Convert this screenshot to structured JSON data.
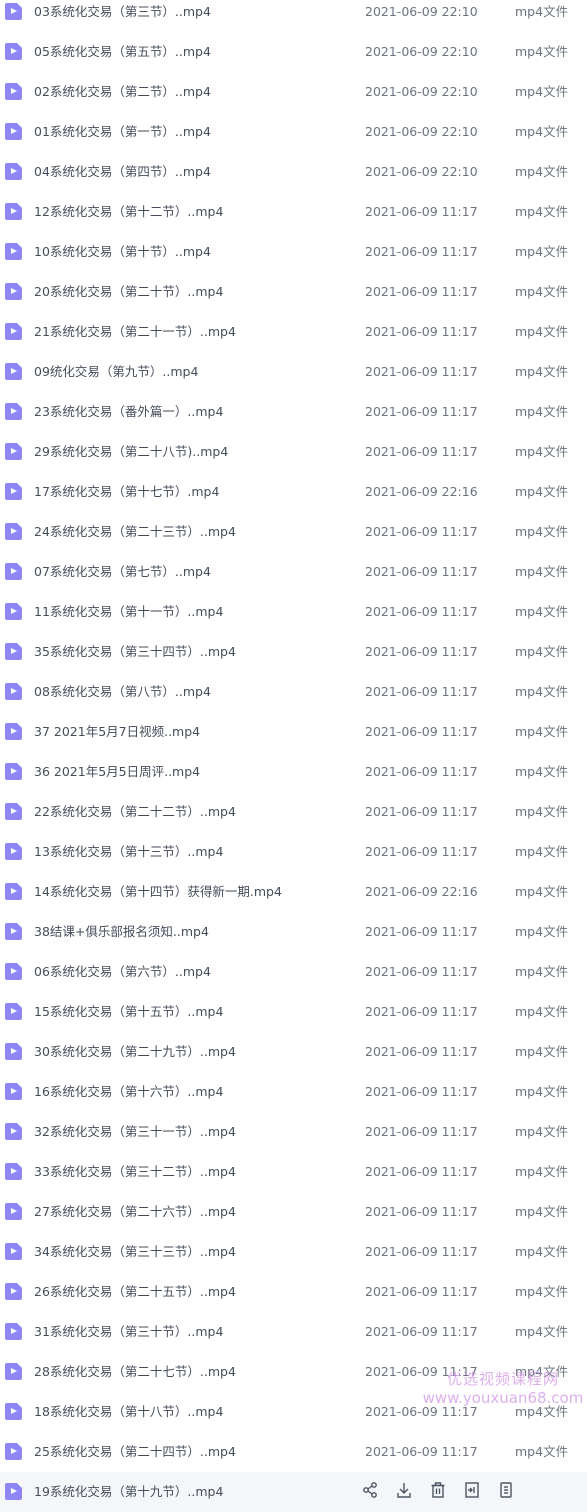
{
  "file_type_label": "mp4文件",
  "files": [
    {
      "name": "03系统化交易（第三节）..mp4",
      "modified": "2021-06-09 22:10"
    },
    {
      "name": "05系统化交易（第五节）..mp4",
      "modified": "2021-06-09 22:10"
    },
    {
      "name": "02系统化交易（第二节）..mp4",
      "modified": "2021-06-09 22:10"
    },
    {
      "name": "01系统化交易（第一节）..mp4",
      "modified": "2021-06-09 22:10"
    },
    {
      "name": "04系统化交易（第四节）..mp4",
      "modified": "2021-06-09 22:10"
    },
    {
      "name": "12系统化交易（第十二节）..mp4",
      "modified": "2021-06-09 11:17"
    },
    {
      "name": "10系统化交易（第十节）..mp4",
      "modified": "2021-06-09 11:17"
    },
    {
      "name": "20系统化交易（第二十节）..mp4",
      "modified": "2021-06-09 11:17"
    },
    {
      "name": "21系统化交易（第二十一节）..mp4",
      "modified": "2021-06-09 11:17"
    },
    {
      "name": "09统化交易（第九节）..mp4",
      "modified": "2021-06-09 11:17"
    },
    {
      "name": "23系统化交易（番外篇一）..mp4",
      "modified": "2021-06-09 11:17"
    },
    {
      "name": "29系统化交易（第二十八节)..mp4",
      "modified": "2021-06-09 11:17"
    },
    {
      "name": "17系统化交易（第十七节）.mp4",
      "modified": "2021-06-09 22:16"
    },
    {
      "name": "24系统化交易（第二十三节）..mp4",
      "modified": "2021-06-09 11:17"
    },
    {
      "name": "07系统化交易（第七节）..mp4",
      "modified": "2021-06-09 11:17"
    },
    {
      "name": "11系统化交易（第十一节）..mp4",
      "modified": "2021-06-09 11:17"
    },
    {
      "name": "35系统化交易（第三十四节）..mp4",
      "modified": "2021-06-09 11:17"
    },
    {
      "name": "08系统化交易（第八节）..mp4",
      "modified": "2021-06-09 11:17"
    },
    {
      "name": "37 2021年5月7日视频..mp4",
      "modified": "2021-06-09 11:17"
    },
    {
      "name": "36 2021年5月5日周评..mp4",
      "modified": "2021-06-09 11:17"
    },
    {
      "name": "22系统化交易（第二十二节）..mp4",
      "modified": "2021-06-09 11:17"
    },
    {
      "name": "13系统化交易（第十三节）..mp4",
      "modified": "2021-06-09 11:17"
    },
    {
      "name": "14系统化交易（第十四节）获得新一期.mp4",
      "modified": "2021-06-09 22:16"
    },
    {
      "name": "38结课+俱乐部报名须知..mp4",
      "modified": "2021-06-09 11:17"
    },
    {
      "name": "06系统化交易（第六节）..mp4",
      "modified": "2021-06-09 11:17"
    },
    {
      "name": "15系统化交易（第十五节）..mp4",
      "modified": "2021-06-09 11:17"
    },
    {
      "name": "30系统化交易（第二十九节）..mp4",
      "modified": "2021-06-09 11:17"
    },
    {
      "name": "16系统化交易（第十六节）..mp4",
      "modified": "2021-06-09 11:17"
    },
    {
      "name": "32系统化交易（第三十一节）..mp4",
      "modified": "2021-06-09 11:17"
    },
    {
      "name": "33系统化交易（第三十二节）..mp4",
      "modified": "2021-06-09 11:17"
    },
    {
      "name": "27系统化交易（第二十六节）..mp4",
      "modified": "2021-06-09 11:17"
    },
    {
      "name": "34系统化交易（第三十三节）..mp4",
      "modified": "2021-06-09 11:17"
    },
    {
      "name": "26系统化交易（第二十五节）..mp4",
      "modified": "2021-06-09 11:17"
    },
    {
      "name": "31系统化交易（第三十节）..mp4",
      "modified": "2021-06-09 11:17"
    },
    {
      "name": "28系统化交易（第二十七节）..mp4",
      "modified": "2021-06-09 11:17"
    },
    {
      "name": "18系统化交易（第十八节）..mp4",
      "modified": "2021-06-09 11:17"
    },
    {
      "name": "25系统化交易（第二十四节）..mp4",
      "modified": "2021-06-09 11:17"
    }
  ],
  "hovered_file": {
    "name": "19系统化交易（第十九节）..mp4"
  },
  "row_actions": [
    {
      "icon": "share-icon"
    },
    {
      "icon": "download-icon"
    },
    {
      "icon": "delete-icon"
    },
    {
      "icon": "move-icon"
    },
    {
      "icon": "more-icon"
    }
  ],
  "watermark": {
    "text_cn": "优选视频课程网",
    "text_url": "www.youxuan68.com"
  }
}
